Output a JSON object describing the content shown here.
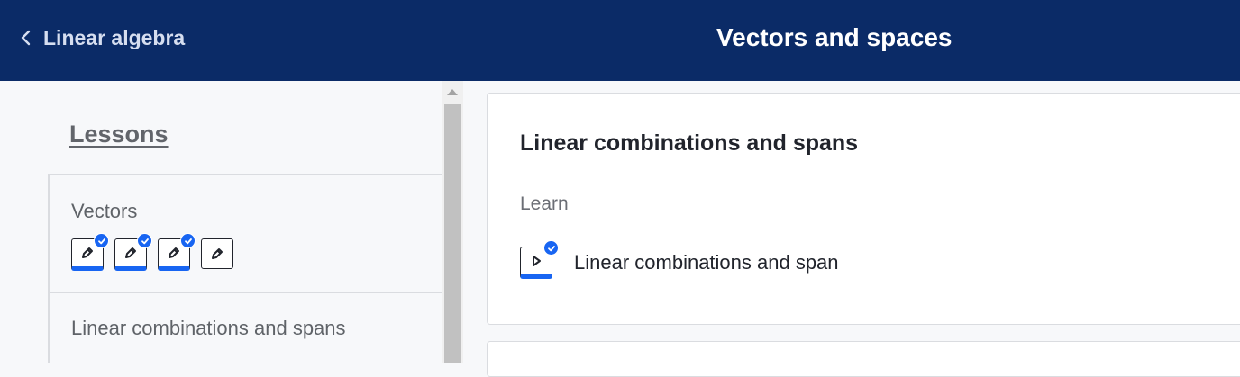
{
  "header": {
    "back_label": "Linear algebra",
    "title": "Vectors and spaces",
    "bg_color": "#0b2b67"
  },
  "sidebar": {
    "heading": "Lessons",
    "lessons": [
      {
        "title": "Vectors",
        "skills": [
          {
            "icon": "pencil-icon",
            "completed": true
          },
          {
            "icon": "pencil-icon",
            "completed": true
          },
          {
            "icon": "pencil-icon",
            "completed": true
          },
          {
            "icon": "pencil-icon",
            "completed": false
          }
        ]
      },
      {
        "title": "Linear combinations and spans"
      }
    ]
  },
  "main": {
    "card": {
      "title": "Linear combinations and spans",
      "section": "Learn",
      "items": [
        {
          "label": "Linear combinations and span",
          "icon": "video-play-icon",
          "completed": true
        }
      ]
    }
  },
  "colors": {
    "accent": "#1865f2",
    "text_dark": "#21242c",
    "text_muted": "#5f6368"
  }
}
